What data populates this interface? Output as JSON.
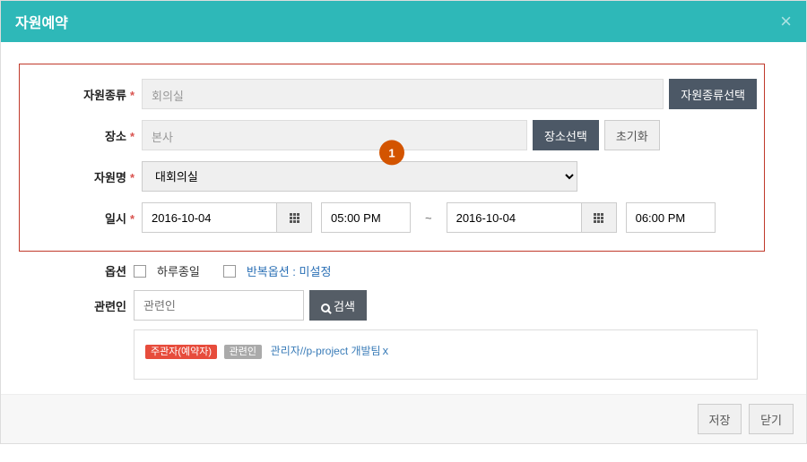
{
  "header": {
    "title": "자원예약"
  },
  "labels": {
    "resourceType": "자원종류",
    "location": "장소",
    "resourceName": "자원명",
    "datetime": "일시",
    "option": "옵션",
    "related": "관련인"
  },
  "form": {
    "resourceType": {
      "value": "회의실",
      "selectBtn": "자원종류선택"
    },
    "location": {
      "value": "본사",
      "selectBtn": "장소선택",
      "resetBtn": "초기화"
    },
    "resourceName": {
      "value": "대회의실"
    },
    "datetime": {
      "startDate": "2016-10-04",
      "startTime": "05:00 PM",
      "separator": "~",
      "endDate": "2016-10-04",
      "endTime": "06:00 PM"
    },
    "option": {
      "allDay": "하루종일",
      "repeat": "반복옵션 : 미설정"
    },
    "related": {
      "placeholder": "관련인",
      "searchBtn": "검색",
      "badges": {
        "host": "주관자(예약자)",
        "rel": "관련인"
      },
      "member": "관리자//p-project 개발팀",
      "removeMark": "x"
    }
  },
  "badgeNum": "1",
  "footer": {
    "save": "저장",
    "close": "닫기"
  }
}
